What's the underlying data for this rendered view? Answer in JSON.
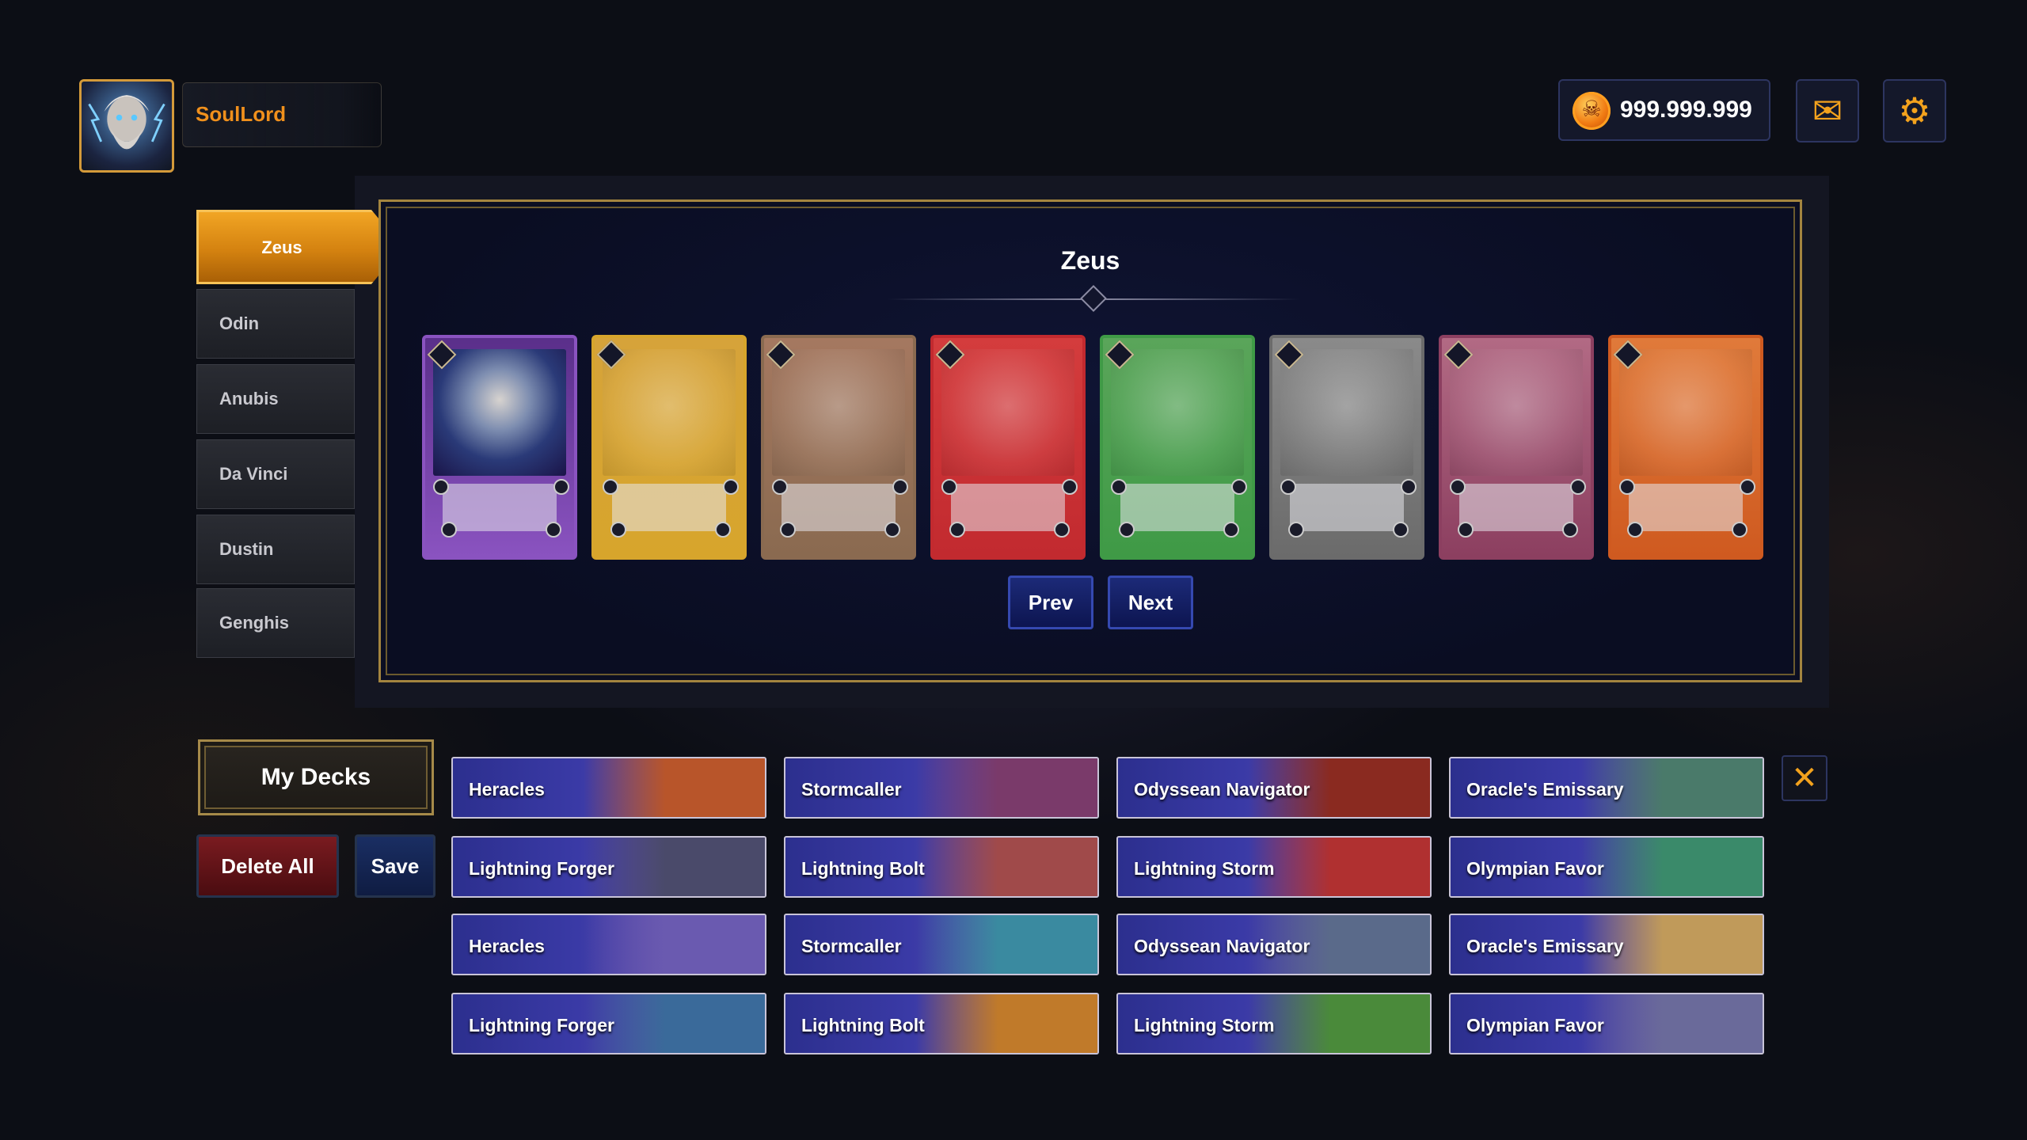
{
  "player": {
    "name": "SoulLord",
    "avatar_icon": "zeus-portrait"
  },
  "currency": {
    "icon": "skull-coin-icon",
    "value": "999.999.999"
  },
  "top_icons": {
    "mail": "✉",
    "settings": "⚙"
  },
  "heroes": [
    {
      "label": "Zeus",
      "active": true
    },
    {
      "label": "Odin",
      "active": false
    },
    {
      "label": "Anubis",
      "active": false
    },
    {
      "label": "Da Vinci",
      "active": false
    },
    {
      "label": "Dustin",
      "active": false
    },
    {
      "label": "Genghis",
      "active": false
    }
  ],
  "panel": {
    "title": "Zeus"
  },
  "cards": [
    {
      "frame": "#8a53c0",
      "fill": "#5a2f8a",
      "has_art": true
    },
    {
      "frame": "#d7a52c",
      "fill": "#d6a33a",
      "has_art": false
    },
    {
      "frame": "#8a6a50",
      "fill": "#a57860",
      "has_art": false
    },
    {
      "frame": "#c22a2f",
      "fill": "#d43c3d",
      "has_art": false
    },
    {
      "frame": "#3f9a46",
      "fill": "#5aa55a",
      "has_art": false
    },
    {
      "frame": "#6b6b6b",
      "fill": "#8a8a8a",
      "has_art": false
    },
    {
      "frame": "#8c3f60",
      "fill": "#b26a84",
      "has_art": false
    },
    {
      "frame": "#cf5a20",
      "fill": "#e07a3a",
      "has_art": false
    }
  ],
  "pagination": {
    "prev": "Prev",
    "next": "Next"
  },
  "decks": {
    "title": "My Decks",
    "delete_all": "Delete All",
    "save": "Save",
    "close": "✕",
    "slots": [
      {
        "label": "Heracles",
        "accent": "#b8552a"
      },
      {
        "label": "Stormcaller",
        "accent": "#7a3a6a"
      },
      {
        "label": "Odyssean Navigator",
        "accent": "#8a2a20"
      },
      {
        "label": "Oracle's Emissary",
        "accent": "#4a7a6a"
      },
      {
        "label": "Lightning Forger",
        "accent": "#4a4a6a"
      },
      {
        "label": "Lightning Bolt",
        "accent": "#a04a4a"
      },
      {
        "label": "Lightning Storm",
        "accent": "#b03030"
      },
      {
        "label": "Olympian Favor",
        "accent": "#3a8a6a"
      },
      {
        "label": "Heracles",
        "accent": "#6a5ab0"
      },
      {
        "label": "Stormcaller",
        "accent": "#3a8aa0"
      },
      {
        "label": "Odyssean Navigator",
        "accent": "#5a6a8a"
      },
      {
        "label": "Oracle's Emissary",
        "accent": "#c09a5a"
      },
      {
        "label": "Lightning Forger",
        "accent": "#3a6a9a"
      },
      {
        "label": "Lightning Bolt",
        "accent": "#c07a2a"
      },
      {
        "label": "Lightning Storm",
        "accent": "#4a8a3a"
      },
      {
        "label": "Olympian Favor",
        "accent": "#6a6a9a"
      }
    ]
  }
}
